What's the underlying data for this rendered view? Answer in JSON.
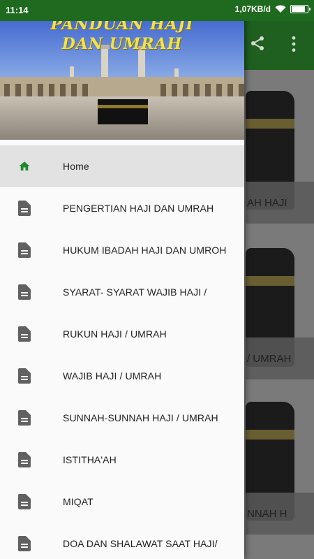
{
  "status_bar": {
    "time": "11:14",
    "speed": "1,07KB/d",
    "icons": [
      "wifi-icon",
      "battery-icon"
    ]
  },
  "header": {
    "title_line1": "PANDUAN HAJI",
    "title_line2": "DAN UMRAH"
  },
  "toolbar": {
    "icons": [
      "share-icon",
      "more-icon"
    ]
  },
  "menu": {
    "items": [
      {
        "label": "Home",
        "icon": "home-icon",
        "active": true
      },
      {
        "label": "PENGERTIAN HAJI DAN UMRAH",
        "icon": "document-icon"
      },
      {
        "label": "HUKUM IBADAH HAJI DAN UMROH",
        "icon": "document-icon"
      },
      {
        "label": "SYARAT- SYARAT WAJIB HAJI /",
        "icon": "document-icon"
      },
      {
        "label": "RUKUN HAJI / UMRAH",
        "icon": "document-icon"
      },
      {
        "label": "WAJIB HAJI / UMRAH",
        "icon": "document-icon"
      },
      {
        "label": "SUNNAH-SUNNAH HAJI / UMRAH",
        "icon": "document-icon"
      },
      {
        "label": "ISTITHA'AH",
        "icon": "document-icon"
      },
      {
        "label": "MIQAT",
        "icon": "document-icon"
      },
      {
        "label": "DOA DAN SHALAWAT SAAT HAJI/",
        "icon": "document-icon"
      }
    ]
  },
  "background_cards": [
    {
      "label": "AH HAJI"
    },
    {
      "label": "/ UMRAH"
    },
    {
      "label": "NNAH H"
    }
  ],
  "colors": {
    "accent": "#1e6a1e",
    "home_icon": "#1e8a2e",
    "active_row": "#e2e2e2",
    "header_text": "#f2e24a"
  }
}
